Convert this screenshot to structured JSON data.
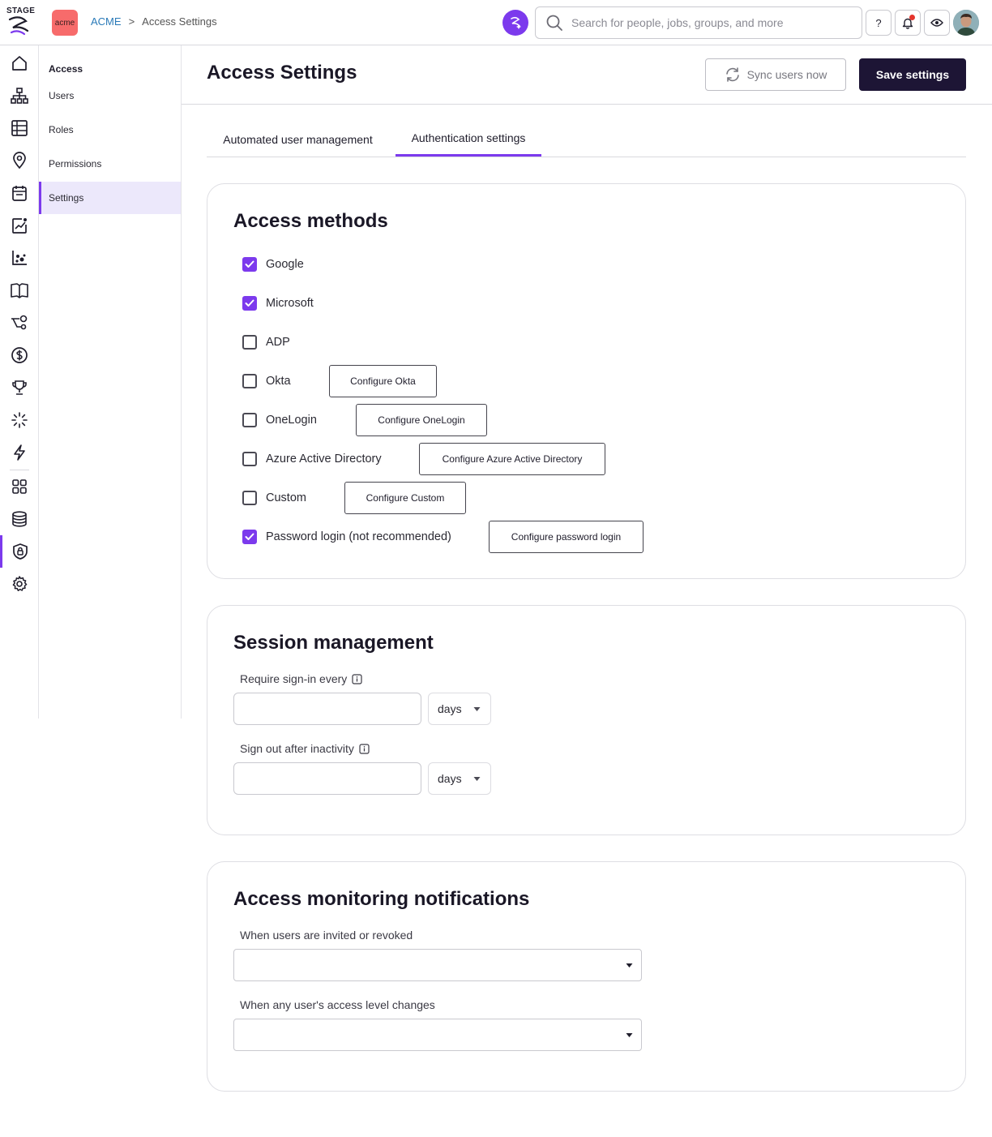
{
  "topbar": {
    "brand": "STAGE",
    "org_logo_text": "acme",
    "breadcrumb": {
      "org": "ACME",
      "separator": ">",
      "current": "Access Settings"
    },
    "search": {
      "placeholder": "Search for people, jobs, groups, and more"
    },
    "help_label": "?"
  },
  "subnav": {
    "heading": "Access",
    "items": [
      {
        "label": "Users"
      },
      {
        "label": "Roles"
      },
      {
        "label": "Permissions"
      },
      {
        "label": "Settings"
      }
    ]
  },
  "page": {
    "title": "Access Settings",
    "sync_label": "Sync users now",
    "save_label": "Save settings"
  },
  "tabs": [
    {
      "label": "Automated user management",
      "active": false
    },
    {
      "label": "Authentication settings",
      "active": true
    }
  ],
  "access_methods": {
    "title": "Access methods",
    "methods": [
      {
        "label": "Google",
        "checked": true,
        "configure_label": ""
      },
      {
        "label": "Microsoft",
        "checked": true,
        "configure_label": ""
      },
      {
        "label": "ADP",
        "checked": false,
        "configure_label": ""
      },
      {
        "label": "Okta",
        "checked": false,
        "configure_label": "Configure Okta"
      },
      {
        "label": "OneLogin",
        "checked": false,
        "configure_label": "Configure OneLogin"
      },
      {
        "label": "Azure Active Directory",
        "checked": false,
        "configure_label": "Configure Azure Active Directory"
      },
      {
        "label": "Custom",
        "checked": false,
        "configure_label": "Configure Custom"
      },
      {
        "label": "Password login (not recommended)",
        "checked": true,
        "configure_label": "Configure password login"
      }
    ]
  },
  "session": {
    "title": "Session management",
    "sign_in": {
      "label": "Require sign-in every",
      "value": "",
      "unit": "days"
    },
    "inactivity": {
      "label": "Sign out after inactivity",
      "value": "",
      "unit": "days"
    }
  },
  "notifications": {
    "title": "Access monitoring notifications",
    "invited": {
      "label": "When users are invited or revoked",
      "value": ""
    },
    "level_change": {
      "label": "When any user's access level changes",
      "value": ""
    }
  },
  "colors": {
    "accent": "#7c3aed",
    "primary_button": "#1d1535",
    "org_logo": "#f76b6b",
    "link": "#2a7ab8"
  }
}
